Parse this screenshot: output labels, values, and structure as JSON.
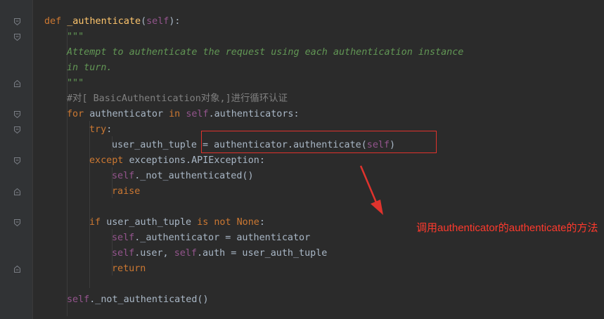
{
  "editor": {
    "colors": {
      "background": "#2b2b2b",
      "keyword": "#cc7832",
      "function_name": "#ffc66d",
      "self": "#94558d",
      "docstring": "#629755",
      "comment": "#808080",
      "default": "#a9b7c6",
      "annotation": "#ff3a2d"
    },
    "lines": [
      {
        "tokens": [
          [
            "kw",
            "def "
          ],
          [
            "fn",
            "_authenticate"
          ],
          [
            "p",
            "("
          ],
          [
            "slf",
            "self"
          ],
          [
            "p",
            "):"
          ]
        ]
      },
      {
        "tokens": [
          [
            "doc",
            "\"\"\""
          ]
        ]
      },
      {
        "tokens": [
          [
            "doc",
            "Attempt to authenticate the request using each authentication instance"
          ]
        ]
      },
      {
        "tokens": [
          [
            "doc",
            "in turn."
          ]
        ]
      },
      {
        "tokens": [
          [
            "doc",
            "\"\"\""
          ]
        ]
      },
      {
        "tokens": [
          [
            "cmt",
            "#对[ BasicAuthentication对象,]进行循环认证"
          ]
        ]
      },
      {
        "tokens": [
          [
            "kw",
            "for "
          ],
          [
            "p",
            "authenticator "
          ],
          [
            "kw",
            "in "
          ],
          [
            "slf",
            "self"
          ],
          [
            "p",
            ".authenticators:"
          ]
        ]
      },
      {
        "tokens": [
          [
            "kw",
            "try"
          ],
          [
            "p",
            ":"
          ]
        ]
      },
      {
        "tokens": [
          [
            "p",
            "user_auth_tuple = authenticator.authenticate("
          ],
          [
            "slf",
            "self"
          ],
          [
            "p",
            ")"
          ]
        ]
      },
      {
        "tokens": [
          [
            "kw",
            "except "
          ],
          [
            "p",
            "exceptions.APIException:"
          ]
        ]
      },
      {
        "tokens": [
          [
            "slf",
            "self"
          ],
          [
            "p",
            "._not_authenticated()"
          ]
        ]
      },
      {
        "tokens": [
          [
            "kw",
            "raise"
          ]
        ]
      },
      {
        "tokens": []
      },
      {
        "tokens": [
          [
            "kw",
            "if "
          ],
          [
            "p",
            "user_auth_tuple "
          ],
          [
            "kw",
            "is not None"
          ],
          [
            "p",
            ":"
          ]
        ]
      },
      {
        "tokens": [
          [
            "slf",
            "self"
          ],
          [
            "p",
            "._authenticator = authenticator"
          ]
        ]
      },
      {
        "tokens": [
          [
            "slf",
            "self"
          ],
          [
            "p",
            ".user, "
          ],
          [
            "slf",
            "self"
          ],
          [
            "p",
            ".auth = user_auth_tuple"
          ]
        ]
      },
      {
        "tokens": [
          [
            "kw",
            "return"
          ]
        ]
      },
      {
        "tokens": []
      },
      {
        "tokens": [
          [
            "slf",
            "self"
          ],
          [
            "p",
            "._not_authenticated()"
          ]
        ]
      }
    ]
  },
  "annotation": {
    "text": "调用authenticator的authenticate的方法"
  }
}
